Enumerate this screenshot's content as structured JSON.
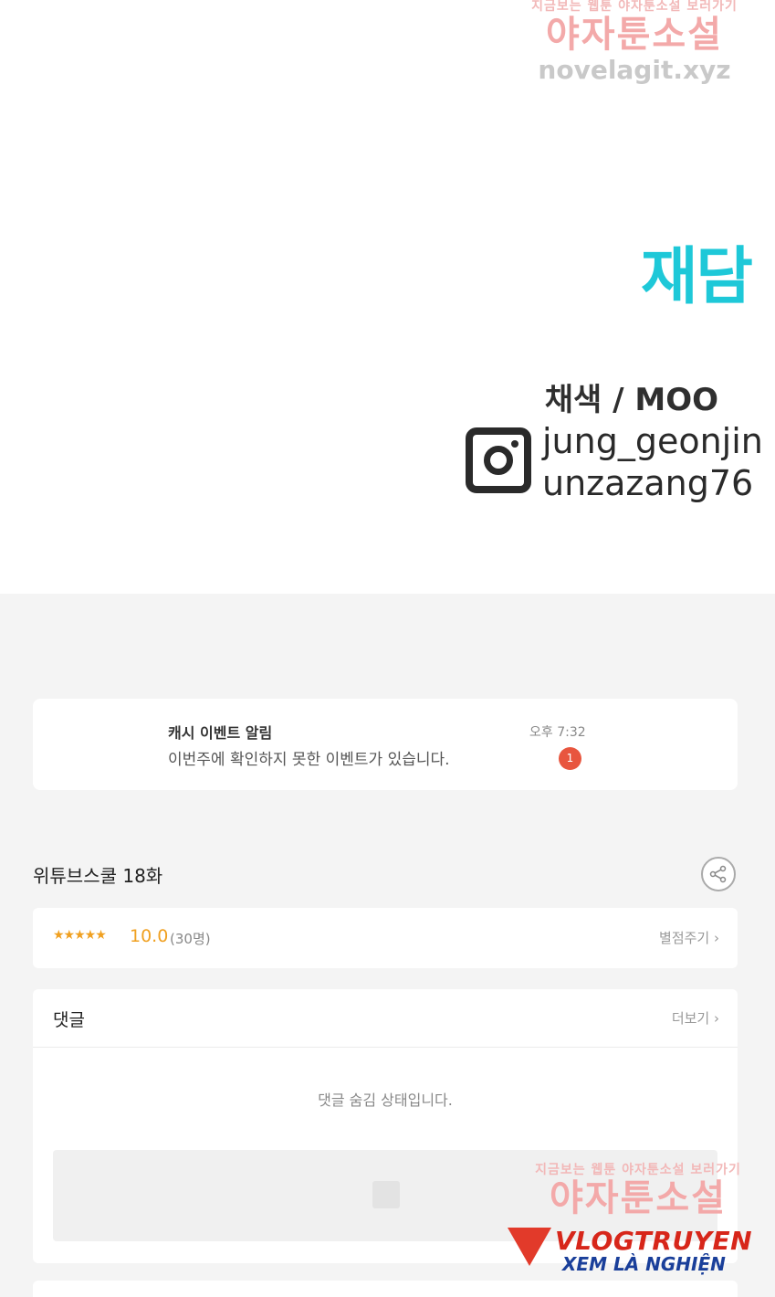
{
  "watermark_top": {
    "tagline": "지금보는 웹툰 야자툰소설 보러가기",
    "brand": "야자툰소설",
    "url": "novelagit.xyz"
  },
  "credits": {
    "studio_logo": "재담",
    "colorist_line": "채색 / MOO",
    "instagram_handle_1": "jung_geonjin",
    "instagram_handle_2": "unzazang76"
  },
  "notification": {
    "title": "캐시 이벤트 알림",
    "body": "이번주에 확인하지 못한 이벤트가 있습니다.",
    "time": "오후 7:32",
    "badge_count": "1"
  },
  "episode": {
    "title": "위튜브스쿨 18화"
  },
  "rating": {
    "stars": "★★★★★",
    "score": "10.0",
    "count": "(30명)",
    "rate_label": "별점주기 ›"
  },
  "comments": {
    "title": "댓글",
    "more_label": "더보기 ›",
    "hidden_message": "댓글 숨김 상태입니다."
  },
  "watermark_bottom": {
    "tagline": "지금보는 웹툰 야자툰소설 보러가기",
    "brand": "야자툰소설",
    "vlog_main": "VLOGTRUYEN",
    "vlog_sub": "XEM LÀ NGHIỆN"
  },
  "colors": {
    "studio_logo": "#1ec8d8",
    "rating": "#f0a020",
    "badge": "#e8553e"
  }
}
